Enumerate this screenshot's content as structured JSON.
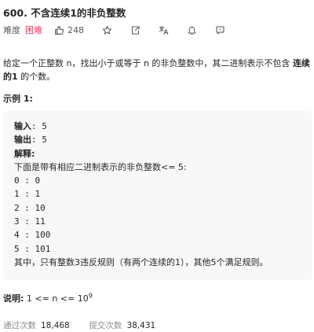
{
  "problem": {
    "title": "600. 不含连续1的非负整数",
    "difficulty_label": "难度",
    "difficulty": "困难",
    "likes": "248"
  },
  "description": {
    "part1": "给定一个正整数 n，找出小于或等于 n 的非负整数中，其二进制表示不包含 ",
    "bold": "连续的1",
    "part2": " 的个数。"
  },
  "example": {
    "title": "示例 1:",
    "input_label": "输入",
    "input_value": ": 5",
    "output_label": "输出",
    "output_value": ": 5",
    "explain_label": "解释",
    "explain_colon": ":",
    "intro": "下面是带有相应二进制表示的非负整数<= 5:",
    "rows": [
      "0 : 0",
      "1 : 1",
      "2 : 10",
      "3 : 11",
      "4 : 100",
      "5 : 101"
    ],
    "conclusion": "其中，只有整数3违反规则（有两个连续的1），其他5个满足规则。"
  },
  "note": {
    "label": "说明:",
    "text": " 1 <= n <= 10",
    "sup": "9"
  },
  "stats": {
    "accepted_label": "通过次数",
    "accepted": "18,468",
    "submitted_label": "提交次数",
    "submitted": "38,431"
  },
  "icons": [
    "thumbs-up-icon",
    "star-icon",
    "share-icon",
    "translate-icon",
    "bell-icon",
    "feedback-icon"
  ],
  "colors": {
    "difficulty_hard": "#ff2d55",
    "example_bg": "#f7f8fa",
    "muted": "#8c8c8c"
  }
}
